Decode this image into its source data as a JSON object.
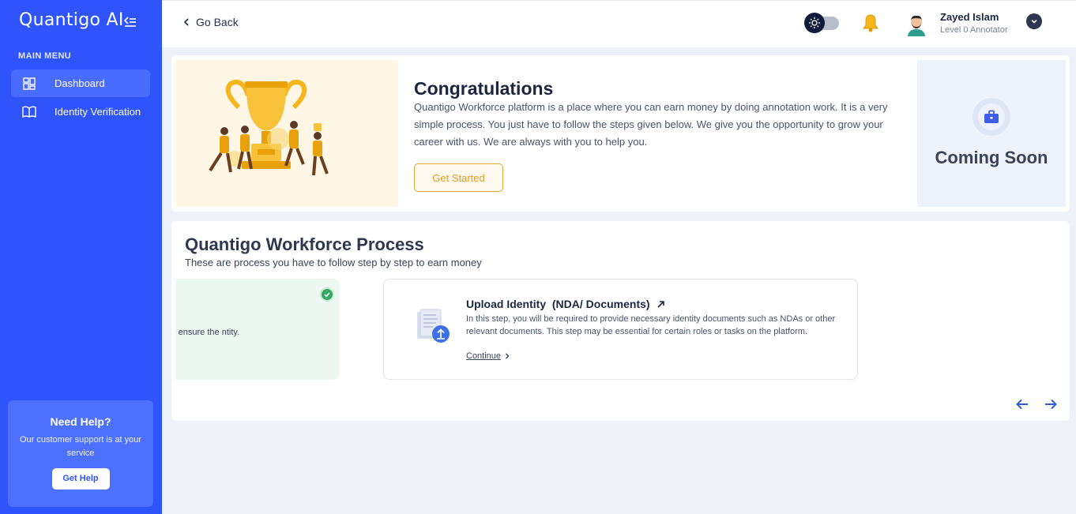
{
  "sidebar": {
    "brand": "Quantigo AI",
    "menu_title": "MAIN MENU",
    "items": [
      {
        "label": "Dashboard",
        "icon": "dashboard-icon",
        "active": true
      },
      {
        "label": "Identity Verification",
        "icon": "book-icon",
        "active": false
      }
    ],
    "help": {
      "title": "Need Help?",
      "text": "Our customer support is at your service",
      "button": "Get Help"
    }
  },
  "topbar": {
    "back_label": "Go Back",
    "user_name": "Zayed Islam",
    "user_role": "Level 0 Annotator"
  },
  "congrats": {
    "title": "Congratulations",
    "text": "Quantigo Workforce platform is a place where you can earn money by doing annotation work. It is a very simple process. You just have to follow the steps given below. We give you the opportunity to grow your career with us. We are always with you to help you.",
    "button": "Get Started",
    "coming_soon": "Coming Soon"
  },
  "process": {
    "title": "Quantigo Workforce Process",
    "subtitle": "These are process you have to follow step by step to earn money",
    "prev_step_text": "ss. This step is crucial to ensure the ntity.",
    "step": {
      "title": "Upload Identity  (NDA/ Documents)",
      "description": "In this step, you will be required to provide necessary identity documents such as NDAs or other relevant documents. This step may be essential for certain roles or tasks on the platform.",
      "link": "Continue"
    }
  },
  "colors": {
    "sidebar_bg": "#2f54fb",
    "accent_orange": "#e29a20",
    "success_green": "#35a865"
  }
}
